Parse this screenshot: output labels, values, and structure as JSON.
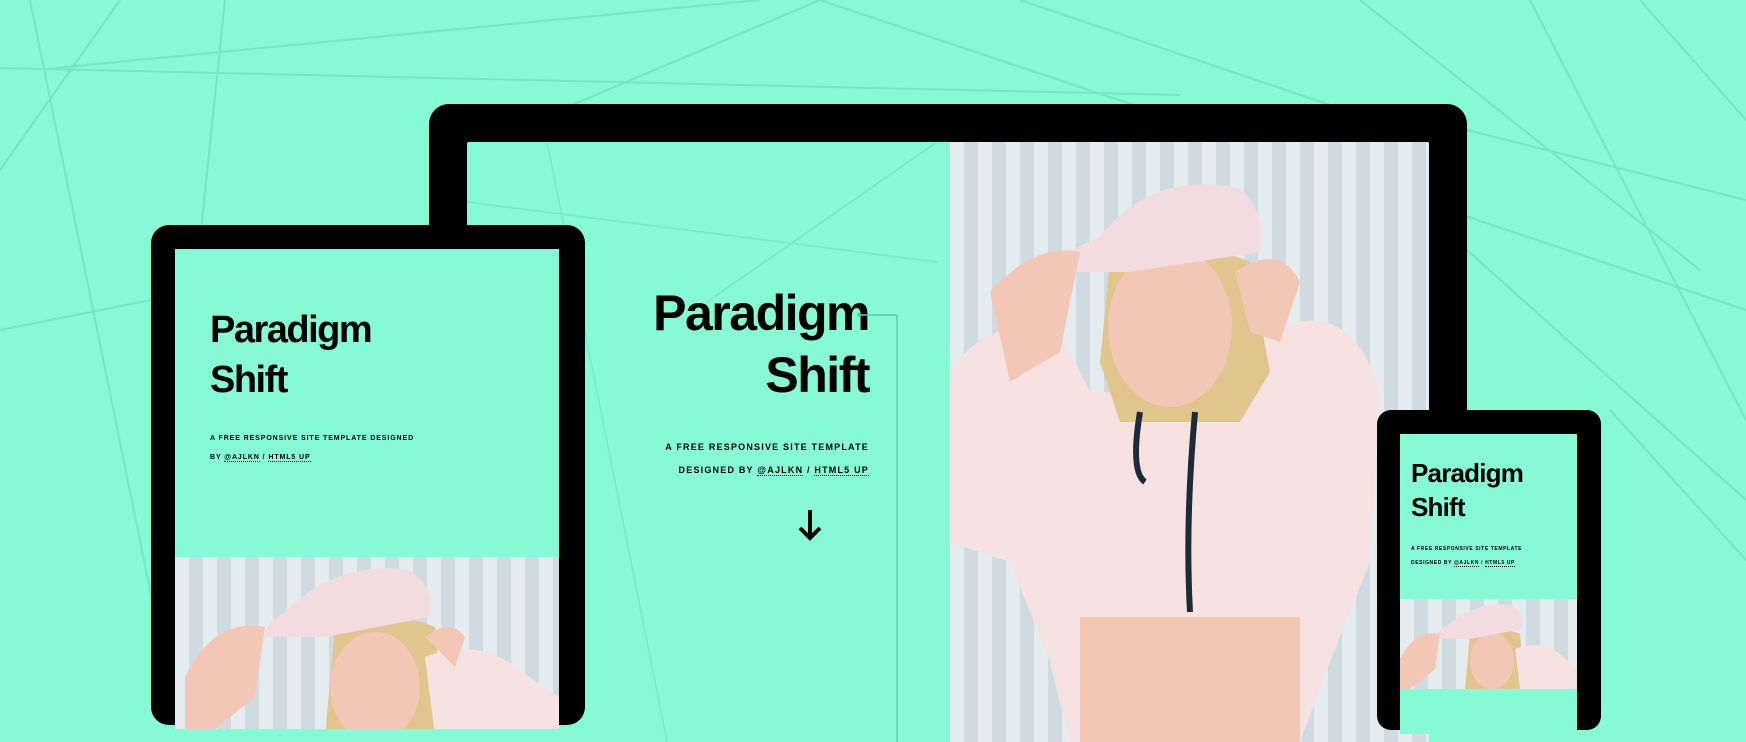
{
  "hero": {
    "title_line1": "Paradigm",
    "title_line2": "Shift",
    "subtitle_line1": "A FREE RESPONSIVE SITE TEMPLATE",
    "subtitle_line2_prefix": "DESIGNED BY ",
    "author_link": "@AJLKN",
    "separator": " / ",
    "brand_link": "HTML5 UP",
    "scroll_icon": "arrow-down-icon"
  },
  "tablet": {
    "title_line1": "Paradigm",
    "title_line2": "Shift",
    "subtitle_line1": "A FREE RESPONSIVE SITE TEMPLATE DESIGNED",
    "subtitle_line2_prefix": "BY ",
    "author_link": "@AJLKN",
    "separator": " / ",
    "brand_link": "HTML5 UP"
  },
  "phone": {
    "title_line1": "Paradigm",
    "title_line2": "Shift",
    "subtitle_line1": "A FREE RESPONSIVE SITE TEMPLATE",
    "subtitle_line2_prefix": "DESIGNED BY ",
    "author_link": "@AJLKN",
    "separator": " / ",
    "brand_link": "HTML5 UP"
  },
  "colors": {
    "background": "#86f9d5",
    "device_frame": "#000000",
    "text": "#000000"
  }
}
